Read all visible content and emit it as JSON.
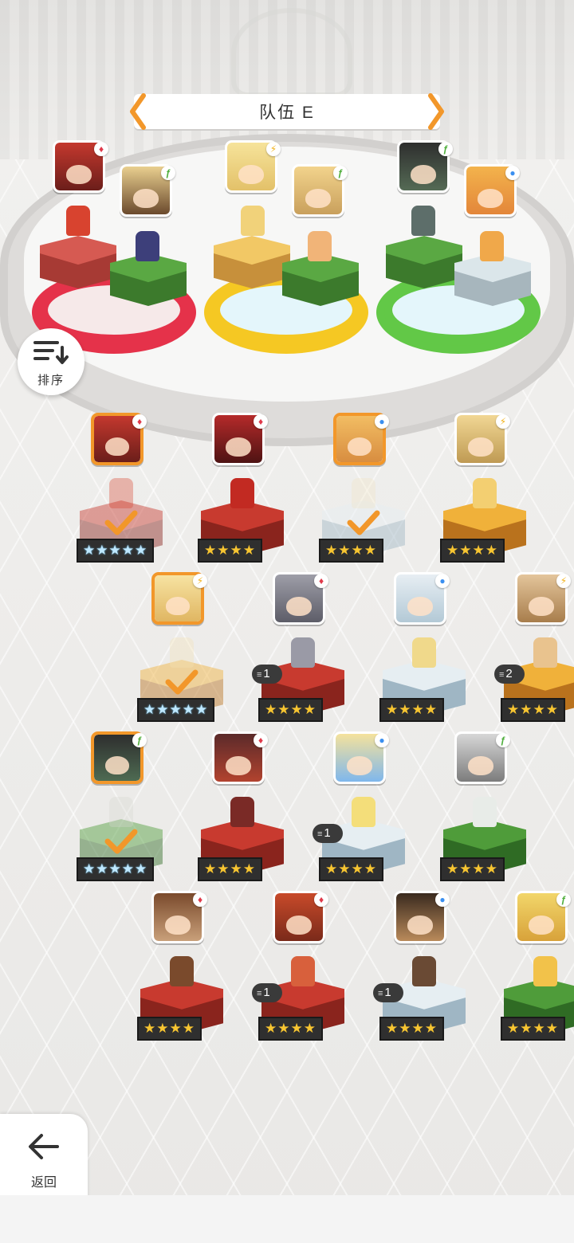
{
  "team": {
    "title": "队伍 E"
  },
  "sort": {
    "label": "排序"
  },
  "back": {
    "label": "返回"
  },
  "colors": {
    "accent": "#f2972a",
    "slot_red": "#e5324a",
    "slot_yellow": "#f5c823",
    "slot_green": "#62c847",
    "star_gold": "#f7c531"
  },
  "team_slots": [
    {
      "ring": "red",
      "members": [
        {
          "element": "fire",
          "icon": "fire-icon"
        },
        {
          "element": "earth",
          "icon": "leaf-icon"
        }
      ]
    },
    {
      "ring": "yellow",
      "members": [
        {
          "element": "lightning",
          "icon": "lightning-icon"
        },
        {
          "element": "earth",
          "icon": "leaf-icon"
        }
      ]
    },
    {
      "ring": "green",
      "members": [
        {
          "element": "earth",
          "icon": "leaf-icon"
        },
        {
          "element": "water",
          "icon": "water-icon"
        }
      ]
    }
  ],
  "roster": [
    {
      "element": "fire",
      "stars": "★★★★★",
      "rainbow": true,
      "selected": true
    },
    {
      "element": "fire",
      "stars": "★★★★",
      "rainbow": false,
      "selected": false
    },
    {
      "element": "water",
      "stars": "★★★★",
      "rainbow": false,
      "selected": true
    },
    {
      "element": "lightning",
      "stars": "★★★★",
      "rainbow": false,
      "selected": false
    },
    {
      "element": "lightning",
      "stars": "★★★★★",
      "rainbow": true,
      "selected": true
    },
    {
      "element": "fire",
      "stars": "★★★★",
      "rainbow": false,
      "selected": false,
      "dupes": "1"
    },
    {
      "element": "water",
      "stars": "★★★★",
      "rainbow": false,
      "selected": false
    },
    {
      "element": "lightning",
      "stars": "★★★★",
      "rainbow": false,
      "selected": false,
      "dupes": "2"
    },
    {
      "element": "earth",
      "stars": "★★★★★",
      "rainbow": true,
      "selected": true
    },
    {
      "element": "fire",
      "stars": "★★★★",
      "rainbow": false,
      "selected": false
    },
    {
      "element": "water",
      "stars": "★★★★",
      "rainbow": false,
      "selected": false,
      "dupes": "1"
    },
    {
      "element": "earth",
      "stars": "★★★★",
      "rainbow": false,
      "selected": false
    },
    {
      "element": "fire",
      "stars": "★★★★",
      "rainbow": false,
      "selected": false
    },
    {
      "element": "fire",
      "stars": "★★★★",
      "rainbow": false,
      "selected": false,
      "dupes": "1"
    },
    {
      "element": "water",
      "stars": "★★★★",
      "rainbow": false,
      "selected": false,
      "dupes": "1"
    },
    {
      "element": "earth",
      "stars": "★★★★",
      "rainbow": false,
      "selected": false
    }
  ]
}
